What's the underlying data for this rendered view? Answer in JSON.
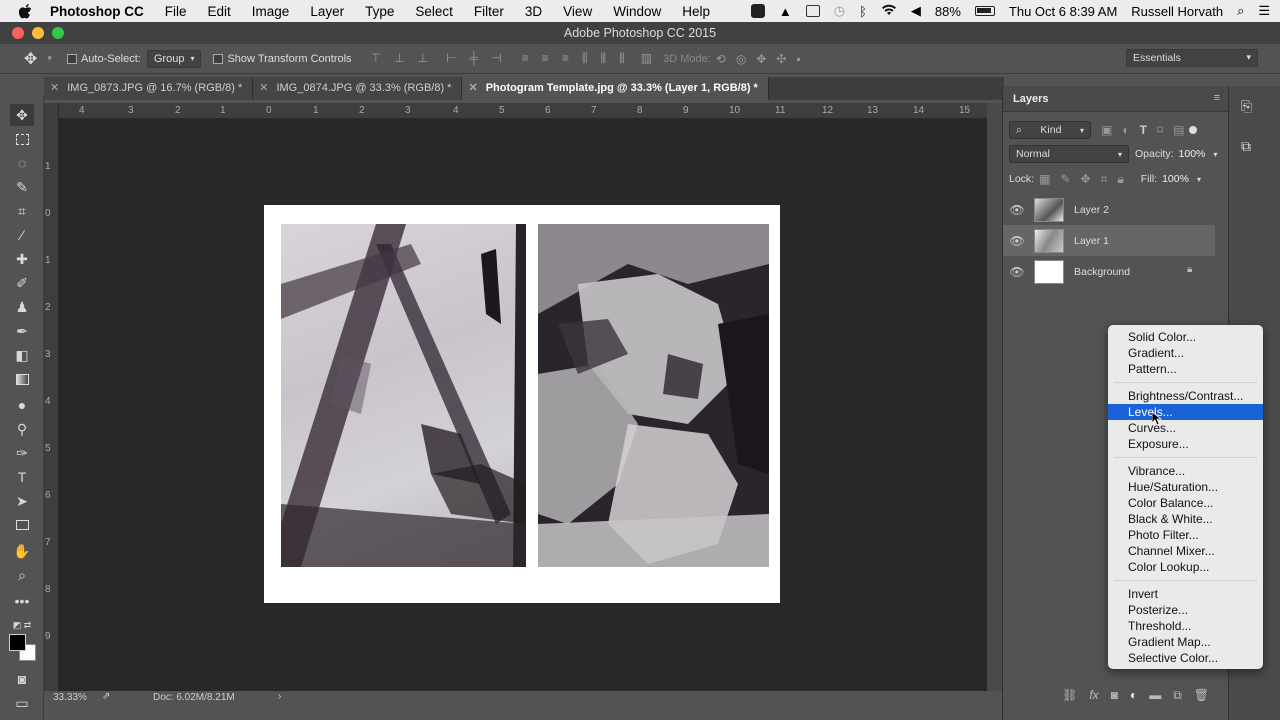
{
  "menubar": {
    "app": "Photoshop CC",
    "items": [
      "File",
      "Edit",
      "Image",
      "Layer",
      "Type",
      "Select",
      "Filter",
      "3D",
      "View",
      "Window",
      "Help"
    ],
    "battery": "88%",
    "datetime": "Thu Oct 6  8:39 AM",
    "user": "Russell Horvath"
  },
  "window": {
    "title": "Adobe Photoshop CC 2015"
  },
  "options": {
    "auto_select_label": "Auto-Select:",
    "auto_select_value": "Group",
    "show_transform_label": "Show Transform Controls",
    "mode_3d_label": "3D Mode:",
    "workspace": "Essentials"
  },
  "tabs": [
    {
      "label": "IMG_0873.JPG @ 16.7% (RGB/8) *"
    },
    {
      "label": "IMG_0874.JPG @ 33.3% (RGB/8) *"
    },
    {
      "label": "Photogram Template.jpg @ 33.3% (Layer 1, RGB/8) *"
    }
  ],
  "ruler": {
    "h": [
      "4",
      "3",
      "2",
      "1",
      "0",
      "1",
      "2",
      "3",
      "4",
      "5",
      "6",
      "7",
      "8",
      "9",
      "10",
      "11",
      "12",
      "13",
      "14",
      "15"
    ],
    "v": [
      "1",
      "0",
      "1",
      "2",
      "3",
      "4",
      "5",
      "6",
      "7",
      "8",
      "9"
    ]
  },
  "status": {
    "zoom": "33.33%",
    "doc": "Doc: 6.02M/8.21M"
  },
  "layers_panel": {
    "title": "Layers",
    "filter": "Kind",
    "blend_mode": "Normal",
    "opacity_label": "Opacity:",
    "opacity": "100%",
    "lock_label": "Lock:",
    "fill_label": "Fill:",
    "fill": "100%",
    "layers": [
      {
        "name": "Layer 2",
        "selected": false
      },
      {
        "name": "Layer 1",
        "selected": true
      },
      {
        "name": "Background",
        "selected": false
      }
    ]
  },
  "adjustment_menu": {
    "groups": [
      [
        "Solid Color...",
        "Gradient...",
        "Pattern..."
      ],
      [
        "Brightness/Contrast...",
        "Levels...",
        "Curves...",
        "Exposure..."
      ],
      [
        "Vibrance...",
        "Hue/Saturation...",
        "Color Balance...",
        "Black & White...",
        "Photo Filter...",
        "Channel Mixer...",
        "Color Lookup..."
      ],
      [
        "Invert",
        "Posterize...",
        "Threshold...",
        "Gradient Map...",
        "Selective Color..."
      ]
    ],
    "highlighted": "Levels...",
    "highlight_color": "#1a62d8"
  }
}
